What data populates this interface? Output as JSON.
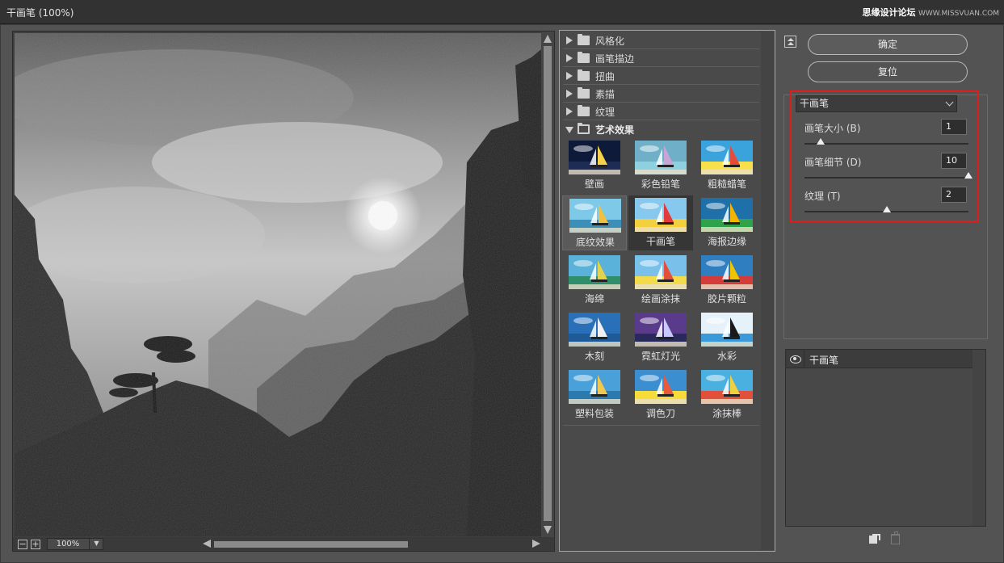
{
  "window": {
    "title": "干画笔 (100%)",
    "watermark_cn": "思缘设计论坛",
    "watermark_url": "WWW.MISSVUAN.COM"
  },
  "preview": {
    "zoom": "100%",
    "zoom_out_symbol": "−",
    "zoom_in_symbol": "+"
  },
  "gallery": {
    "categories": [
      {
        "label": "风格化",
        "open": false
      },
      {
        "label": "画笔描边",
        "open": false
      },
      {
        "label": "扭曲",
        "open": false
      },
      {
        "label": "素描",
        "open": false
      },
      {
        "label": "纹理",
        "open": false
      },
      {
        "label": "艺术效果",
        "open": true
      }
    ],
    "filters": [
      {
        "label": "壁画",
        "icon": "fresco-thumbnail"
      },
      {
        "label": "彩色铅笔",
        "icon": "colored-pencil-thumbnail"
      },
      {
        "label": "粗糙蜡笔",
        "icon": "rough-pastels-thumbnail"
      },
      {
        "label": "底纹效果",
        "icon": "underpainting-thumbnail"
      },
      {
        "label": "干画笔",
        "icon": "dry-brush-thumbnail",
        "selected": true
      },
      {
        "label": "海报边缘",
        "icon": "poster-edges-thumbnail"
      },
      {
        "label": "海绵",
        "icon": "sponge-thumbnail"
      },
      {
        "label": "绘画涂抹",
        "icon": "paint-daubs-thumbnail"
      },
      {
        "label": "胶片颗粒",
        "icon": "film-grain-thumbnail"
      },
      {
        "label": "木刻",
        "icon": "cutout-thumbnail"
      },
      {
        "label": "霓虹灯光",
        "icon": "neon-glow-thumbnail"
      },
      {
        "label": "水彩",
        "icon": "watercolor-thumbnail"
      },
      {
        "label": "塑料包装",
        "icon": "plastic-wrap-thumbnail"
      },
      {
        "label": "调色刀",
        "icon": "palette-knife-thumbnail"
      },
      {
        "label": "涂抹棒",
        "icon": "smudge-stick-thumbnail"
      }
    ]
  },
  "actions": {
    "ok_label": "确定",
    "reset_label": "复位"
  },
  "settings": {
    "filter_select": "干画笔",
    "params": [
      {
        "label": "画笔大小 (B)",
        "value": "1",
        "min": 0,
        "max": 10,
        "level": 1
      },
      {
        "label": "画笔细节 (D)",
        "value": "10",
        "min": 0,
        "max": 10,
        "level": 10
      },
      {
        "label": "纹理 (T)",
        "value": "2",
        "min": 1,
        "max": 3,
        "level": 2
      }
    ]
  },
  "layers": {
    "items": [
      {
        "label": "干画笔",
        "visible": true
      }
    ]
  },
  "colors": {
    "accent_highlight": "#e41b1b",
    "panel_bg": "#535353"
  }
}
